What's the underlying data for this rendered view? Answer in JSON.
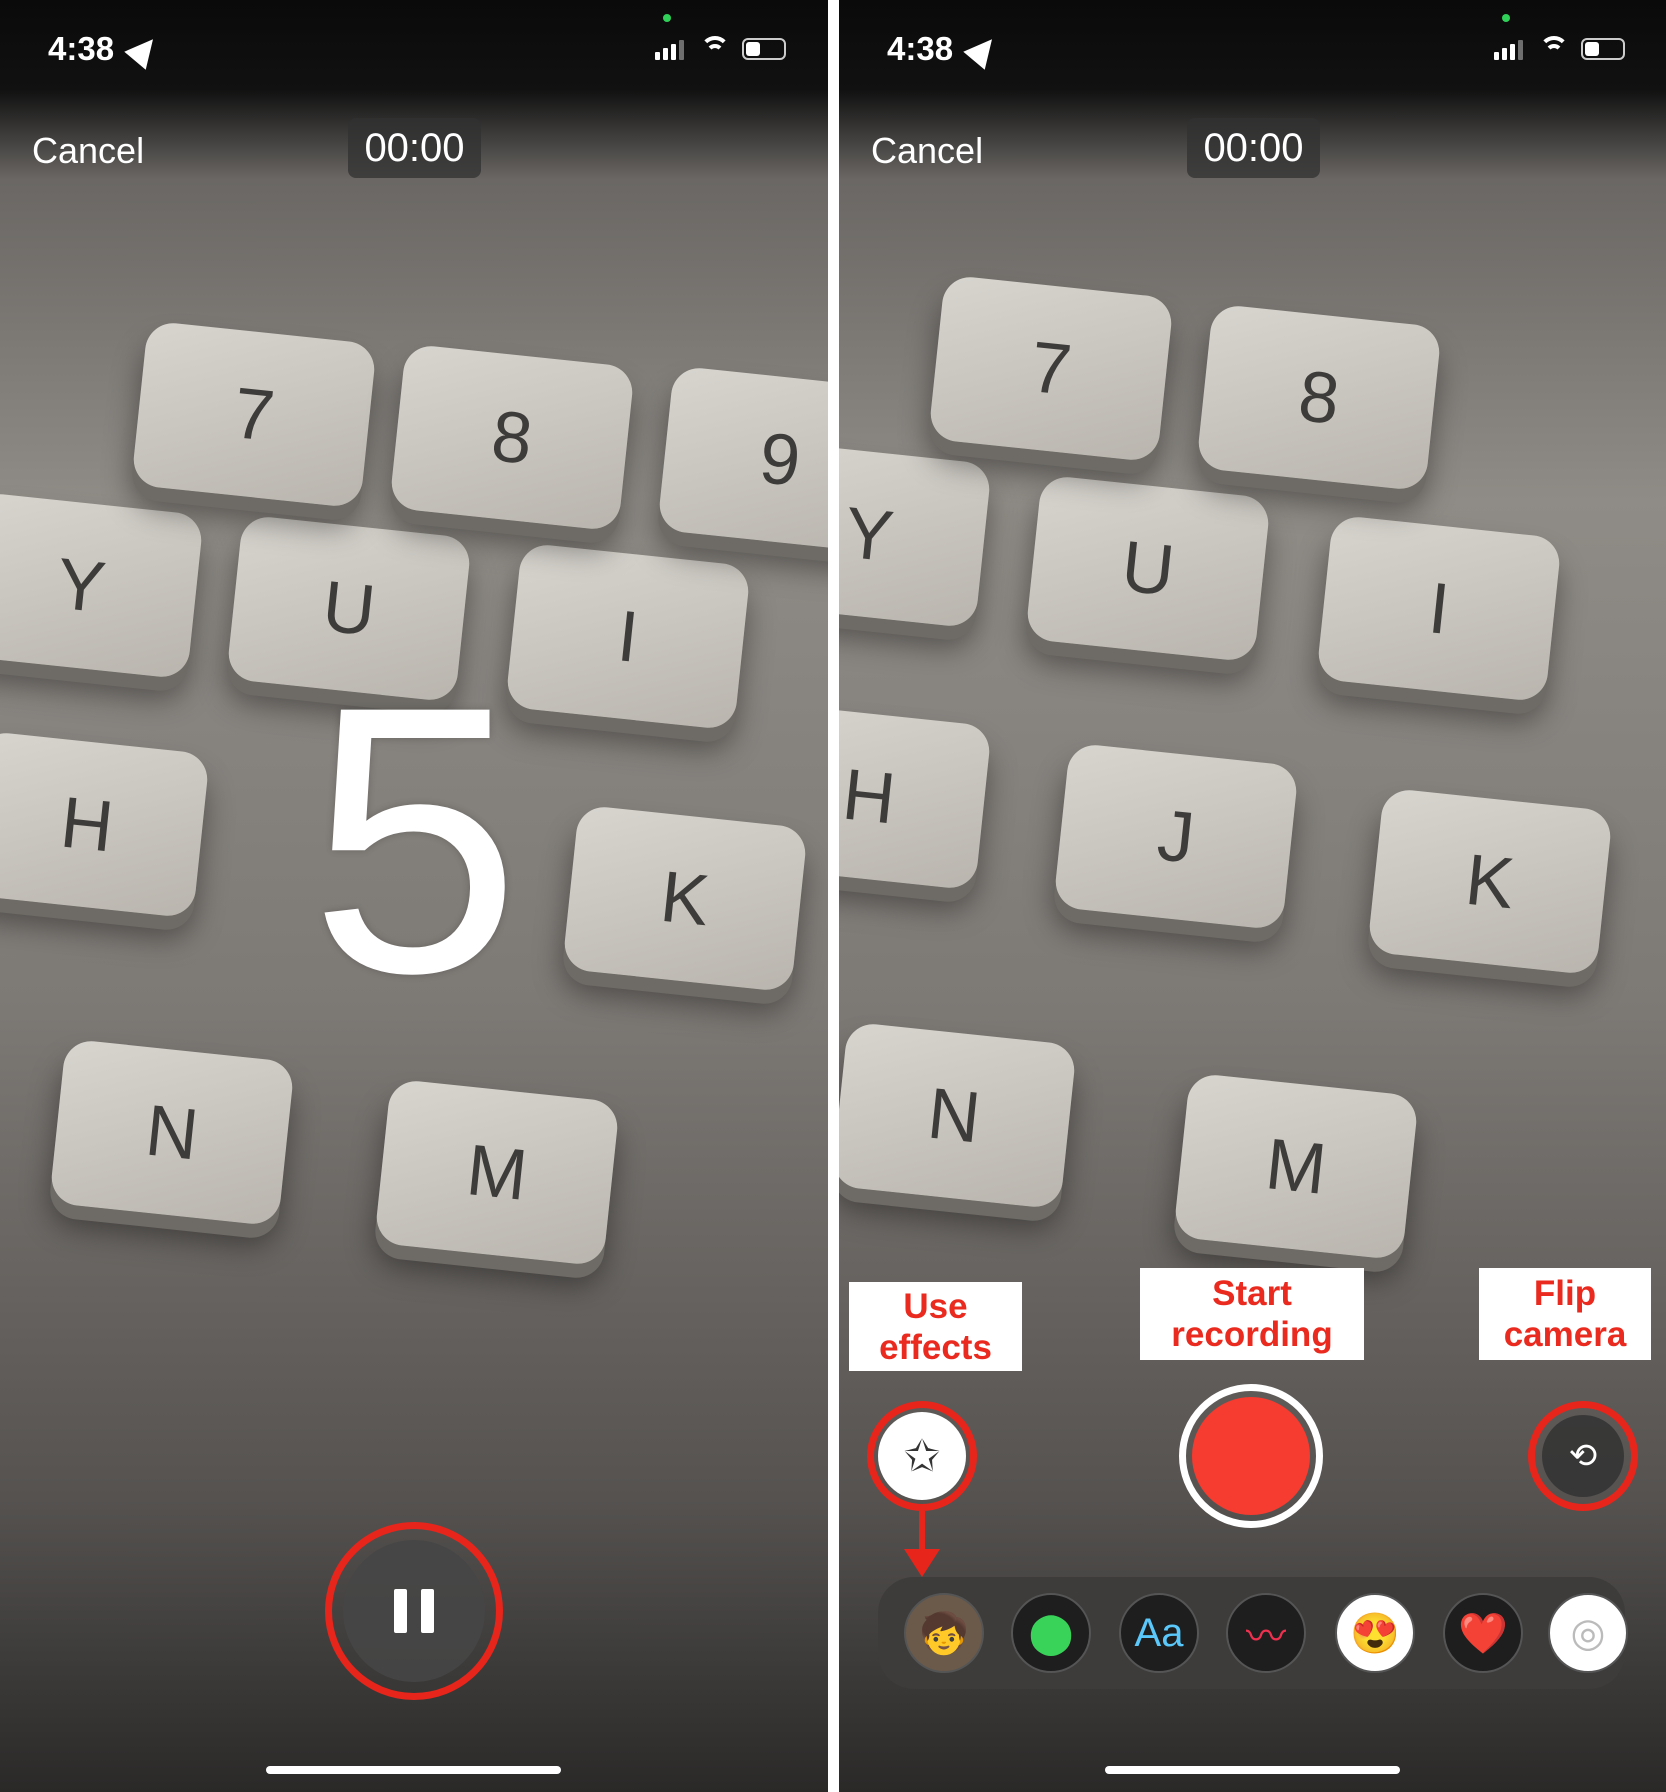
{
  "left_screen": {
    "status": {
      "time": "4:38"
    },
    "cancel_label": "Cancel",
    "timer": "00:00",
    "countdown": "5",
    "keys": [
      "Y",
      "U",
      "I",
      "H",
      "K",
      "N",
      "M",
      "7",
      "8",
      "9"
    ]
  },
  "right_screen": {
    "status": {
      "time": "4:38"
    },
    "cancel_label": "Cancel",
    "timer": "00:00",
    "keys": [
      "Y",
      "U",
      "I",
      "H",
      "J",
      "K",
      "N",
      "M",
      "7",
      "8"
    ],
    "annotations": {
      "use_effects": "Use effects",
      "start_recording": "Start recording",
      "flip_camera": "Flip camera"
    },
    "effects_tray": [
      {
        "name": "memoji",
        "glyph": "🧒"
      },
      {
        "name": "filters",
        "glyph": "⬤"
      },
      {
        "name": "text",
        "glyph": "Aa"
      },
      {
        "name": "shapes",
        "glyph": "〰"
      },
      {
        "name": "memoji-stickers",
        "glyph": "😍"
      },
      {
        "name": "emoji-stickers",
        "glyph": "❤️"
      },
      {
        "name": "fitness",
        "glyph": "◎"
      }
    ]
  },
  "colors": {
    "annotation_red": "#e8251b",
    "record_red": "#f63b30",
    "text_blue": "#5ac8fa"
  }
}
